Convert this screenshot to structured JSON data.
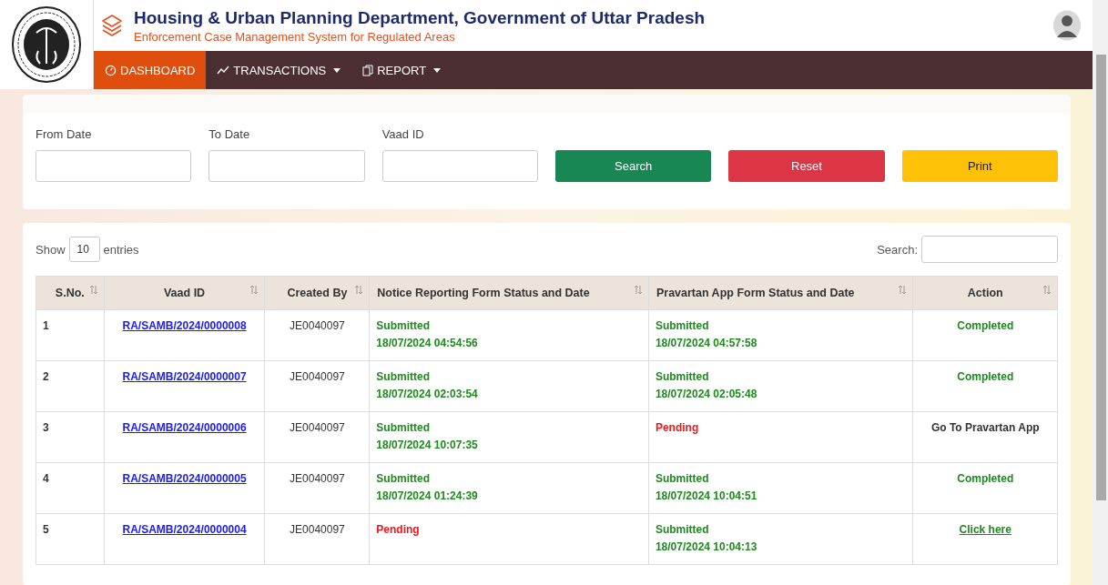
{
  "header": {
    "title": "Housing & Urban Planning Department, Government of Uttar Pradesh",
    "subtitle": "Enforcement Case Management System for Regulated Areas"
  },
  "nav": [
    {
      "label": "DASHBOARD",
      "kind": "gauge",
      "selected": true,
      "dropdown": false
    },
    {
      "label": "TRANSACTIONS",
      "kind": "trend",
      "selected": false,
      "dropdown": true
    },
    {
      "label": "REPORT",
      "kind": "document",
      "selected": false,
      "dropdown": true
    }
  ],
  "filters": [
    {
      "label": "From Date"
    },
    {
      "label": "To Date"
    },
    {
      "label": "Vaad ID"
    }
  ],
  "buttons": [
    {
      "label": "Search",
      "kind": "success"
    },
    {
      "label": "Reset",
      "kind": "danger"
    },
    {
      "label": "Print",
      "kind": "warning"
    }
  ],
  "table": {
    "show_label": "Show",
    "page_size": "10",
    "entries_label": "entries",
    "search_label": "Search:",
    "columns": [
      "S.No.",
      "Vaad ID",
      "Created By",
      "Notice Reporting Form Status and Date",
      "Pravartan App Form Status and Date",
      "Action"
    ],
    "rows": [
      {
        "sno": "1",
        "vaad_id": "RA/SAMB/2024/0000008",
        "created_by": "JE0040097",
        "notice": {
          "kind": "submitted",
          "status": "Submitted",
          "date": "18/07/2024 04:54:56"
        },
        "pravartan": {
          "kind": "submitted",
          "status": "Submitted",
          "date": "18/07/2024 04:57:58"
        },
        "action": {
          "kind": "completed",
          "text": "Completed"
        }
      },
      {
        "sno": "2",
        "vaad_id": "RA/SAMB/2024/0000007",
        "created_by": "JE0040097",
        "notice": {
          "kind": "submitted",
          "status": "Submitted",
          "date": "18/07/2024 02:03:54"
        },
        "pravartan": {
          "kind": "submitted",
          "status": "Submitted",
          "date": "18/07/2024 02:05:48"
        },
        "action": {
          "kind": "completed",
          "text": "Completed"
        }
      },
      {
        "sno": "3",
        "vaad_id": "RA/SAMB/2024/0000006",
        "created_by": "JE0040097",
        "notice": {
          "kind": "submitted",
          "status": "Submitted",
          "date": "18/07/2024 10:07:35"
        },
        "pravartan": {
          "kind": "pending",
          "status": "Pending"
        },
        "action": {
          "kind": "plain",
          "text": "Go To Pravartan App"
        }
      },
      {
        "sno": "4",
        "vaad_id": "RA/SAMB/2024/0000005",
        "created_by": "JE0040097",
        "notice": {
          "kind": "submitted",
          "status": "Submitted",
          "date": "18/07/2024 01:24:39"
        },
        "pravartan": {
          "kind": "submitted",
          "status": "Submitted",
          "date": "18/07/2024 10:04:51"
        },
        "action": {
          "kind": "completed",
          "text": "Completed"
        }
      },
      {
        "sno": "5",
        "vaad_id": "RA/SAMB/2024/0000004",
        "created_by": "JE0040097",
        "notice": {
          "kind": "pending",
          "status": "Pending"
        },
        "pravartan": {
          "kind": "submitted",
          "status": "Submitted",
          "date": "18/07/2024 10:04:13"
        },
        "action": {
          "kind": "link",
          "text": "Click here"
        }
      }
    ]
  }
}
